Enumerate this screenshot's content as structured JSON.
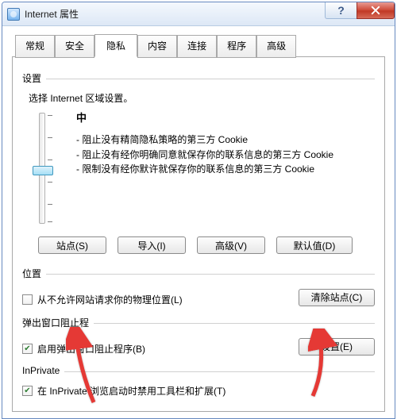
{
  "window": {
    "title": "Internet 属性"
  },
  "tabs": [
    "常规",
    "安全",
    "隐私",
    "内容",
    "连接",
    "程序",
    "高级"
  ],
  "settings": {
    "label": "设置",
    "zone_text": "选择 Internet 区域设置。",
    "level_title": "中",
    "bullets": [
      "- 阻止没有精简隐私策略的第三方 Cookie",
      "- 阻止没有经你明确同意就保存你的联系信息的第三方 Cookie",
      "- 限制没有经你默许就保存你的联系信息的第三方 Cookie"
    ],
    "buttons": {
      "sites": "站点(S)",
      "import": "导入(I)",
      "advanced": "高级(V)",
      "default": "默认值(D)"
    }
  },
  "location": {
    "label": "位置",
    "checkbox": "从不允许网站请求你的物理位置(L)",
    "clear": "清除站点(C)"
  },
  "popup": {
    "label": "弹出窗口阻止程",
    "checkbox": "启用弹出窗口阻止程序(B)",
    "settings": "设置(E)"
  },
  "inprivate": {
    "label": "InPrivate",
    "checkbox": "在 InPrivate 浏览启动时禁用工具栏和扩展(T)"
  }
}
